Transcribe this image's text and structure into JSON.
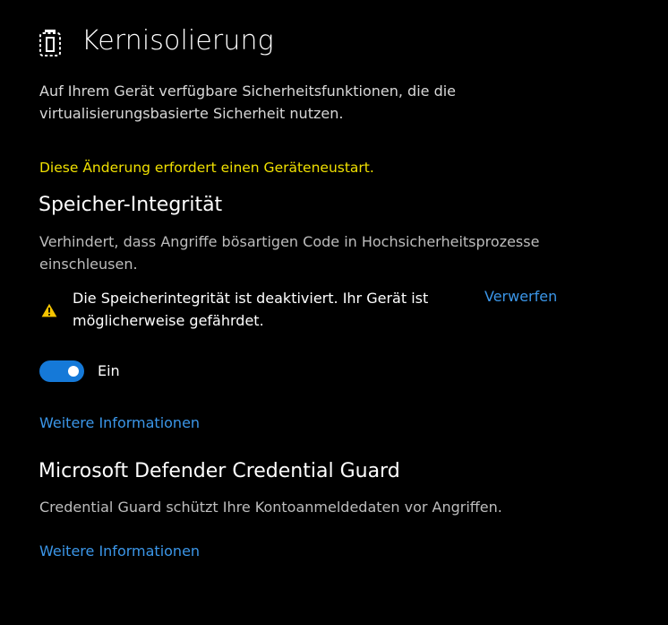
{
  "header": {
    "icon": "core-isolation-icon",
    "title": "Kernisolierung",
    "description": "Auf Ihrem Gerät verfügbare Sicherheitsfunktionen, die die virtualisierungsbasierte Sicherheit nutzen."
  },
  "restart_notice": "Diese Änderung erfordert einen Geräteneustart.",
  "memory_integrity": {
    "heading": "Speicher-Integrität",
    "description": "Verhindert, dass Angriffe bösartigen Code in Hochsicherheitsprozesse einschleusen.",
    "warning": {
      "icon": "warning-icon",
      "text": "Die Speicherintegrität ist deaktiviert. Ihr Gerät ist möglicherweise gefährdet.",
      "dismiss_label": "Verwerfen"
    },
    "toggle": {
      "state": "on",
      "label": "Ein"
    },
    "more_info_label": "Weitere Informationen"
  },
  "credential_guard": {
    "heading": "Microsoft Defender Credential Guard",
    "description": "Credential Guard schützt Ihre Kontoanmeldedaten vor Angriffen.",
    "more_info_label": "Weitere Informationen"
  },
  "colors": {
    "background": "#000000",
    "notice_yellow": "#f0e000",
    "link_blue": "#3b96e8",
    "toggle_blue": "#1579d8",
    "warning_amber": "#f5c400"
  }
}
